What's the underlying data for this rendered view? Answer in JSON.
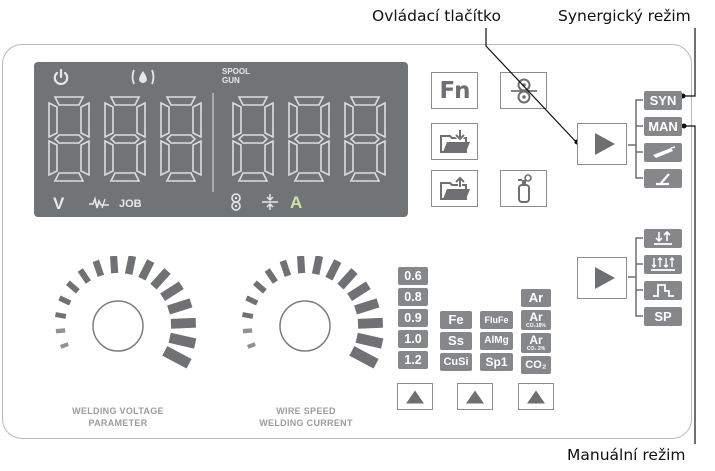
{
  "callouts": {
    "control_button": "Ovládací tlačítko",
    "synergic_mode": "Synergický režim",
    "manual_mode": "Manuální režim"
  },
  "display": {
    "left_digits": "888",
    "right_digits": "888",
    "spool_gun_line1": "SPOOL",
    "spool_gun_line2": "GUN",
    "unit_v": "V",
    "job_label": "JOB",
    "unit_a": "A"
  },
  "function_buttons": {
    "fn_label": "Fn"
  },
  "mode_buttons": {
    "syn": "SYN",
    "man": "MAN",
    "sp": "SP"
  },
  "selectors": {
    "wire_diameters": [
      "0.6",
      "0.8",
      "0.9",
      "1.0",
      "1.2"
    ],
    "materials": [
      "Fe",
      "Ss",
      "CuSi"
    ],
    "wire_types": [
      "FluFe",
      "AlMg",
      "Sp1"
    ],
    "gases": [
      {
        "main": "Ar",
        "sub": ""
      },
      {
        "main": "Ar",
        "sub": "CO₂18%"
      },
      {
        "main": "Ar",
        "sub": "CO₂ 2%"
      },
      {
        "main": "CO₂",
        "sub": ""
      }
    ]
  },
  "knobs": {
    "left_line1": "WELDING VOLTAGE",
    "left_line2": "PARAMETER",
    "right_line1": "WIRE SPEED",
    "right_line2": "WELDING CURRENT"
  },
  "colors": {
    "display_bg": "#717477",
    "button_gray": "#85878a",
    "display_text": "#e6e7e8",
    "accent_green": "#cfe3a8"
  },
  "icons": {
    "power": "power-icon",
    "gas": "gas-drop-icon",
    "arc": "arc-dynamic-icon",
    "spool": "spool-icon",
    "wire_feed": "wire-feed-icon",
    "load_folder": "folder-load-icon",
    "save_folder": "folder-save-icon",
    "gas_cylinder": "gas-cylinder-icon",
    "torch": "torch-icon",
    "trigger_2t": "trigger-2t-icon",
    "trigger_4t": "trigger-4t-icon",
    "crater": "crater-fill-icon"
  }
}
